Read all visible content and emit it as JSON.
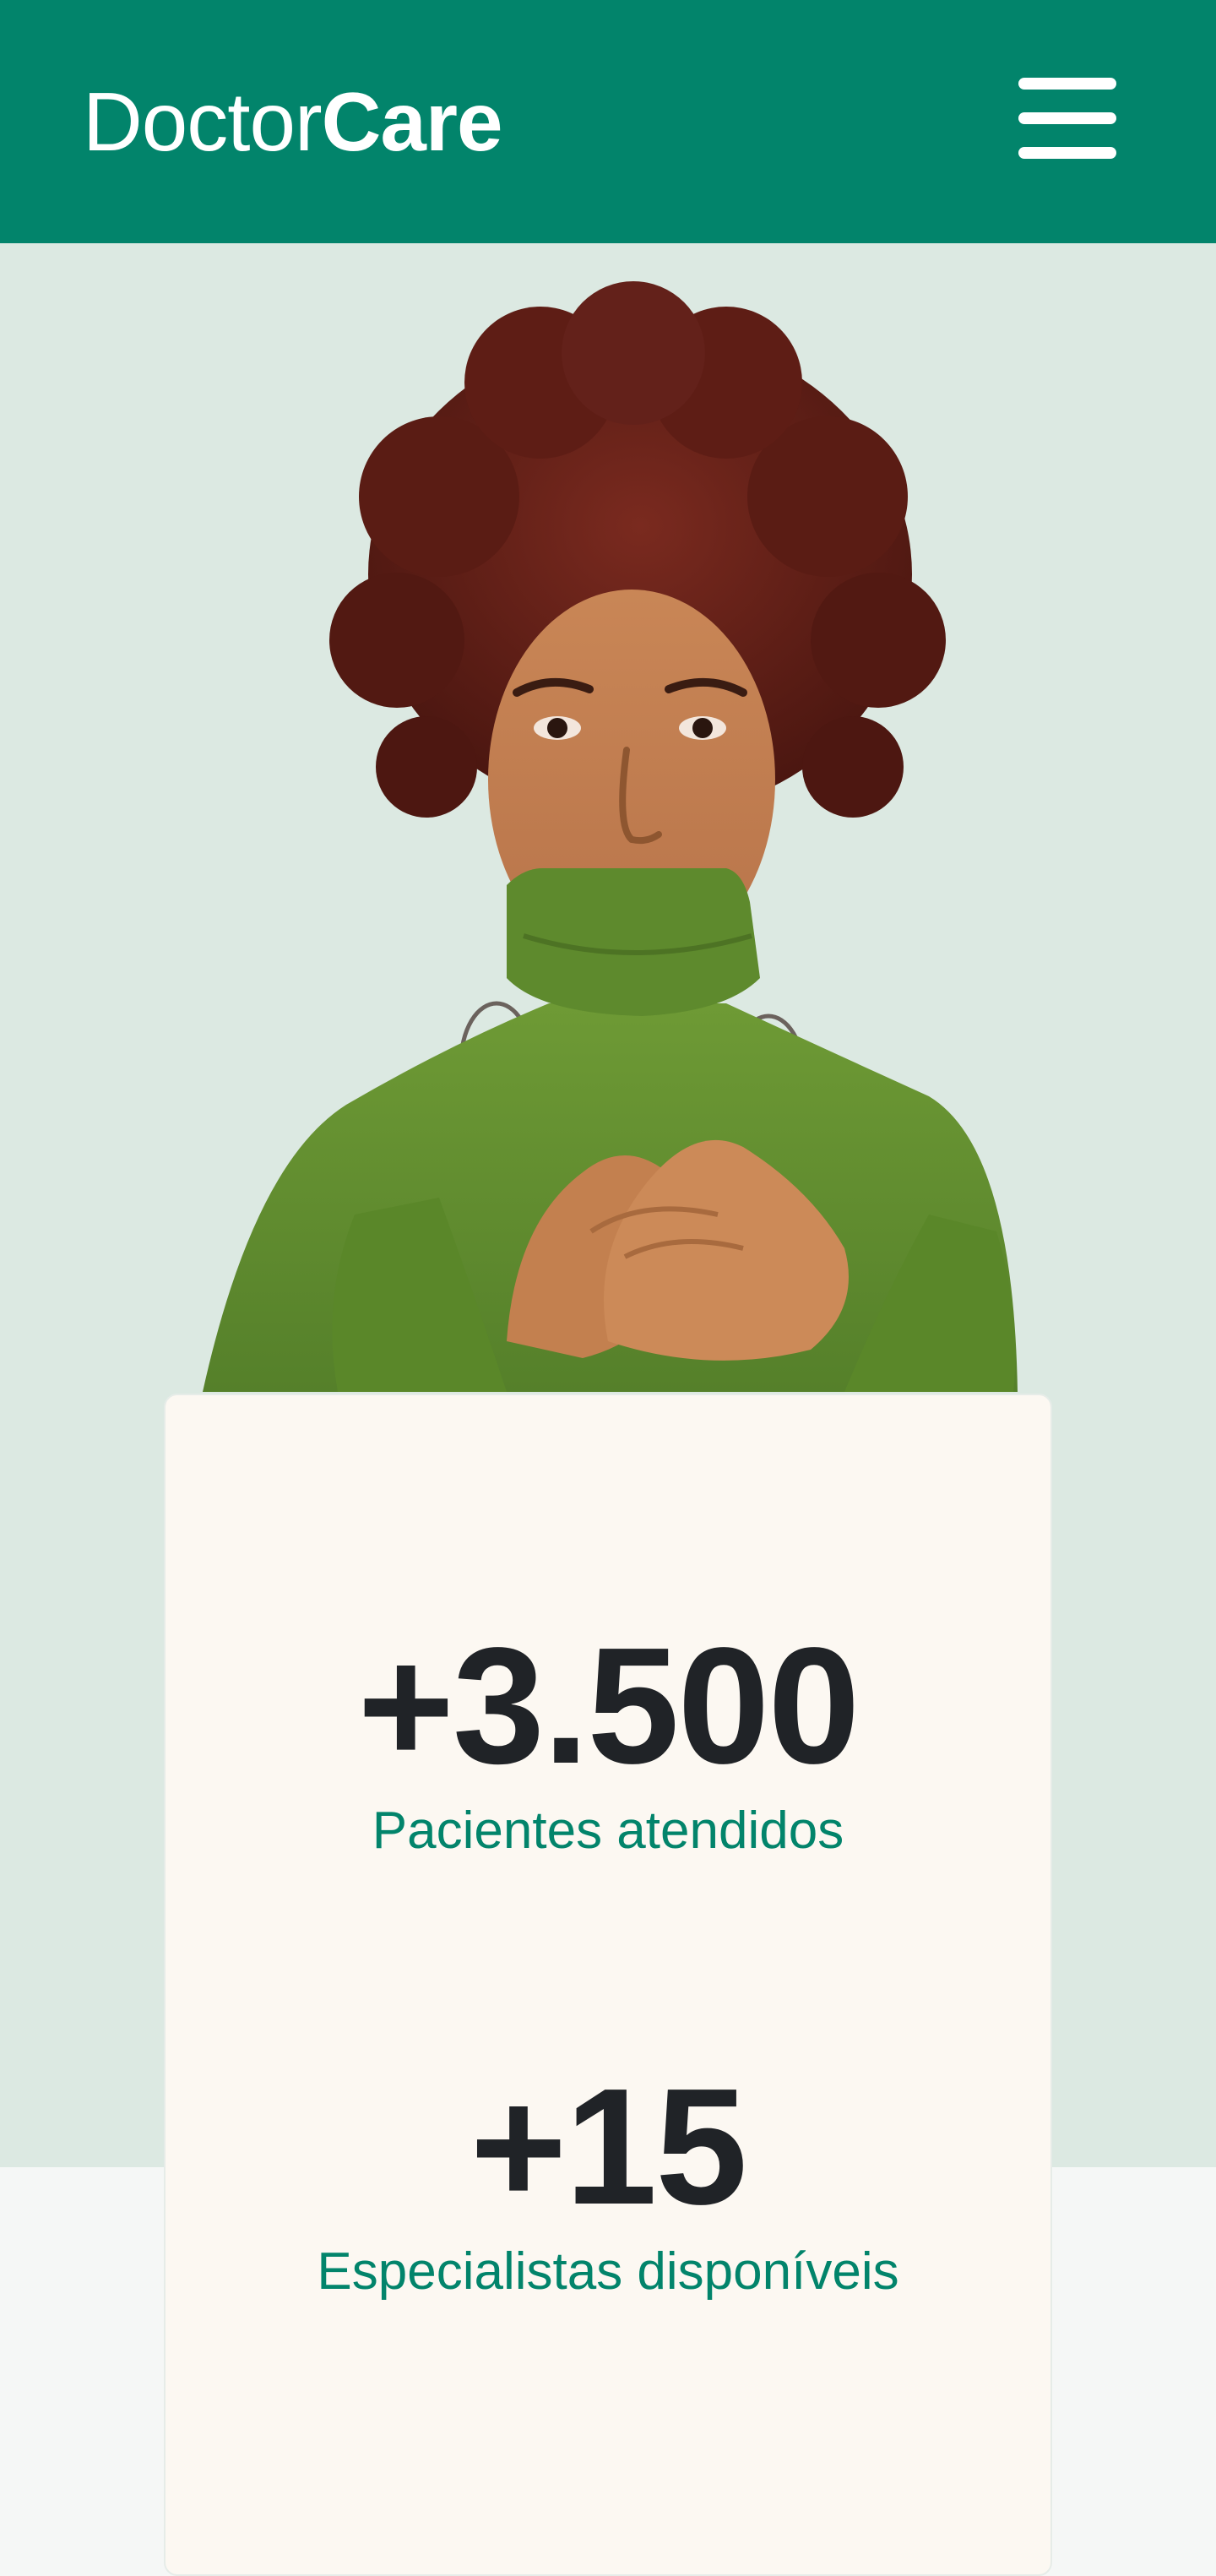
{
  "header": {
    "logo_light": "Doctor",
    "logo_bold": "Care",
    "menu_icon": "hamburger-menu-icon"
  },
  "hero": {
    "image_description": "smiling woman in green turtleneck with hands on chest"
  },
  "stats": [
    {
      "value": "+3.500",
      "label": "Pacientes atendidos"
    },
    {
      "value": "+15",
      "label": "Especialistas disponíveis"
    }
  ],
  "colors": {
    "brand_green": "#02846b",
    "hero_background": "#dce9e2",
    "card_background": "#fcf8f2",
    "page_background": "#f5f7f6",
    "stat_value": "#202327"
  }
}
